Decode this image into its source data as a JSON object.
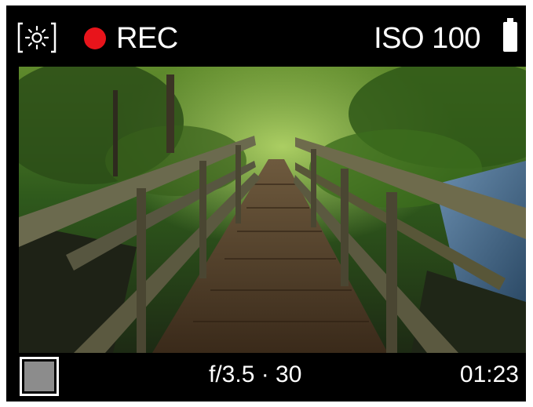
{
  "status_bar": {
    "white_balance_icon": "sun-bracket-icon",
    "record_indicator_color": "#e8141b",
    "record_label": "REC",
    "iso_label": "ISO 100",
    "battery_icon": "battery-full-icon"
  },
  "viewfinder": {
    "scene": "wooden-footbridge-forest-photo"
  },
  "controls": {
    "stop_button_icon": "stop-square-icon",
    "exposure_readout": "f/3.5 · 30",
    "recording_time": "01:23"
  },
  "colors": {
    "background": "#000000",
    "text": "#ffffff",
    "record_red": "#e8141b",
    "stop_fill": "#8c8c8c"
  }
}
